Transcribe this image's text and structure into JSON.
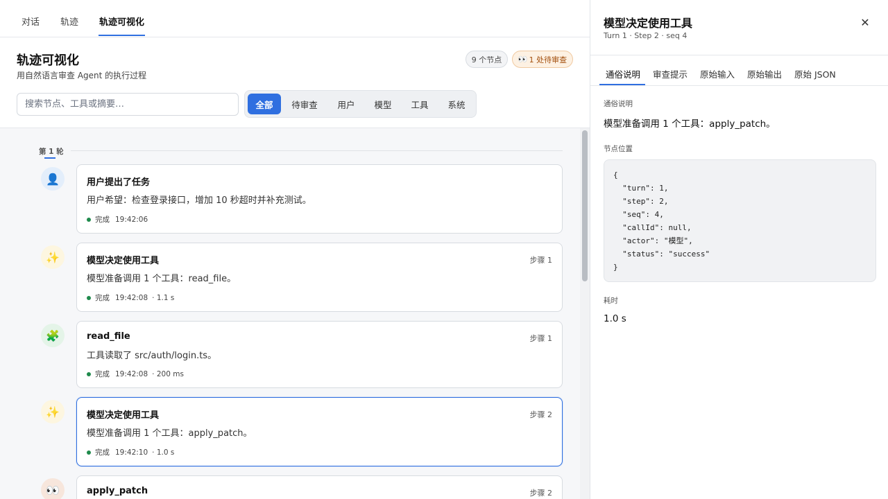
{
  "topnav": {
    "tabs": [
      "对话",
      "轨迹",
      "轨迹可视化"
    ]
  },
  "header": {
    "title": "轨迹可视化",
    "subtitle": "用自然语言审查 Agent 的执行过程",
    "badge_nodes": "9 个节点",
    "badge_review": "1 处待审查",
    "search_placeholder": "搜索节点、工具或摘要…",
    "filters": [
      "全部",
      "待审查",
      "用户",
      "模型",
      "工具",
      "系统"
    ]
  },
  "timeline": {
    "round_label": "第 1 轮",
    "nodes": [
      {
        "title": "用户提出了任务",
        "step": "",
        "desc": "用户希望：检查登录接口，增加 10 秒超时并补充测试。",
        "status": "完成",
        "time": "19:42:06",
        "duration": "",
        "icon": "user-icon"
      },
      {
        "title": "模型决定使用工具",
        "step": "步骤 1",
        "desc": "模型准备调用 1 个工具：read_file。",
        "status": "完成",
        "time": "19:42:08",
        "duration": "· 1.1 s",
        "icon": "sparkles-icon"
      },
      {
        "title": "read_file",
        "step": "步骤 1",
        "desc": "工具读取了 src/auth/login.ts。",
        "status": "完成",
        "time": "19:42:08",
        "duration": "· 200 ms",
        "icon": "puzzle-icon"
      },
      {
        "title": "模型决定使用工具",
        "step": "步骤 2",
        "desc": "模型准备调用 1 个工具：apply_patch。",
        "status": "完成",
        "time": "19:42:10",
        "duration": "· 1.0 s",
        "icon": "sparkles-icon"
      },
      {
        "title": "apply_patch",
        "step": "步骤 2",
        "desc": "",
        "status": "",
        "time": "",
        "duration": "",
        "icon": "eyes-icon"
      }
    ]
  },
  "detail": {
    "title": "模型决定使用工具",
    "subtitle": "Turn 1 · Step 2 · seq 4",
    "tabs": [
      "通俗说明",
      "审查提示",
      "原始输入",
      "原始输出",
      "原始 JSON"
    ],
    "explain_label": "通俗说明",
    "explain_text": "模型准备调用 1 个工具：apply_patch。",
    "position_label": "节点位置",
    "position_json": "{\n  \"turn\": 1,\n  \"step\": 2,\n  \"seq\": 4,\n  \"callId\": null,\n  \"actor\": \"模型\",\n  \"status\": \"success\"\n}",
    "duration_label": "耗时",
    "duration_value": "1.0 s"
  },
  "colors": {
    "accent": "#2f6fe0",
    "success_dot": "#1f8a4c",
    "review_badge": "#a3500f"
  }
}
